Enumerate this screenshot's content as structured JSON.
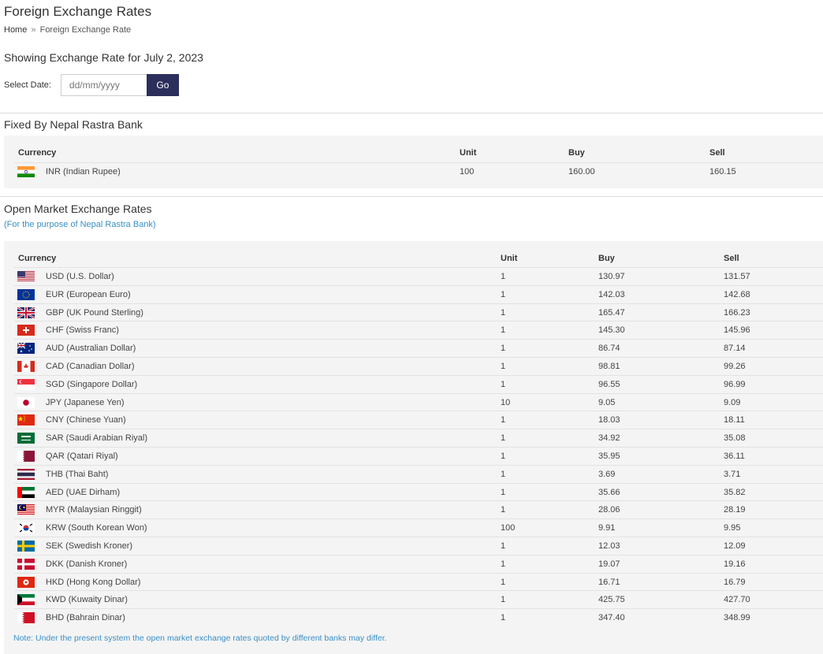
{
  "page": {
    "title": "Foreign Exchange Rates",
    "breadcrumb": {
      "home": "Home",
      "separator": "»",
      "current": "Foreign Exchange Rate"
    },
    "showing": "Showing Exchange Rate for July 2, 2023"
  },
  "date_form": {
    "label": "Select Date:",
    "placeholder": "dd/mm/yyyy",
    "go_label": "Go"
  },
  "fixed": {
    "title": "Fixed By Nepal Rastra Bank",
    "headers": {
      "currency": "Currency",
      "unit": "Unit",
      "buy": "Buy",
      "sell": "Sell"
    },
    "rows": [
      {
        "currency": "INR (Indian Rupee)",
        "flag": "in",
        "unit": "100",
        "buy": "160.00",
        "sell": "160.15"
      }
    ]
  },
  "open_market": {
    "title": "Open Market Exchange Rates",
    "subtitle": "(For the purpose of Nepal Rastra Bank)",
    "headers": {
      "currency": "Currency",
      "unit": "Unit",
      "buy": "Buy",
      "sell": "Sell"
    },
    "rows": [
      {
        "currency": "USD (U.S. Dollar)",
        "flag": "us",
        "unit": "1",
        "buy": "130.97",
        "sell": "131.57"
      },
      {
        "currency": "EUR (European Euro)",
        "flag": "eu",
        "unit": "1",
        "buy": "142.03",
        "sell": "142.68"
      },
      {
        "currency": "GBP (UK Pound Sterling)",
        "flag": "gb",
        "unit": "1",
        "buy": "165.47",
        "sell": "166.23"
      },
      {
        "currency": "CHF (Swiss Franc)",
        "flag": "ch",
        "unit": "1",
        "buy": "145.30",
        "sell": "145.96"
      },
      {
        "currency": "AUD (Australian Dollar)",
        "flag": "au",
        "unit": "1",
        "buy": "86.74",
        "sell": "87.14"
      },
      {
        "currency": "CAD (Canadian Dollar)",
        "flag": "ca",
        "unit": "1",
        "buy": "98.81",
        "sell": "99.26"
      },
      {
        "currency": "SGD (Singapore Dollar)",
        "flag": "sg",
        "unit": "1",
        "buy": "96.55",
        "sell": "96.99"
      },
      {
        "currency": "JPY (Japanese Yen)",
        "flag": "jp",
        "unit": "10",
        "buy": "9.05",
        "sell": "9.09"
      },
      {
        "currency": "CNY (Chinese Yuan)",
        "flag": "cn",
        "unit": "1",
        "buy": "18.03",
        "sell": "18.11"
      },
      {
        "currency": "SAR (Saudi Arabian Riyal)",
        "flag": "sa",
        "unit": "1",
        "buy": "34.92",
        "sell": "35.08"
      },
      {
        "currency": "QAR (Qatari Riyal)",
        "flag": "qa",
        "unit": "1",
        "buy": "35.95",
        "sell": "36.11"
      },
      {
        "currency": "THB (Thai Baht)",
        "flag": "th",
        "unit": "1",
        "buy": "3.69",
        "sell": "3.71"
      },
      {
        "currency": "AED (UAE Dirham)",
        "flag": "ae",
        "unit": "1",
        "buy": "35.66",
        "sell": "35.82"
      },
      {
        "currency": "MYR (Malaysian Ringgit)",
        "flag": "my",
        "unit": "1",
        "buy": "28.06",
        "sell": "28.19"
      },
      {
        "currency": "KRW (South Korean Won)",
        "flag": "kr",
        "unit": "100",
        "buy": "9.91",
        "sell": "9.95"
      },
      {
        "currency": "SEK (Swedish Kroner)",
        "flag": "se",
        "unit": "1",
        "buy": "12.03",
        "sell": "12.09"
      },
      {
        "currency": "DKK (Danish Kroner)",
        "flag": "dk",
        "unit": "1",
        "buy": "19.07",
        "sell": "19.16"
      },
      {
        "currency": "HKD (Hong Kong Dollar)",
        "flag": "hk",
        "unit": "1",
        "buy": "16.71",
        "sell": "16.79"
      },
      {
        "currency": "KWD (Kuwaity Dinar)",
        "flag": "kw",
        "unit": "1",
        "buy": "425.75",
        "sell": "427.70"
      },
      {
        "currency": "BHD (Bahrain Dinar)",
        "flag": "bh",
        "unit": "1",
        "buy": "347.40",
        "sell": "348.99"
      }
    ]
  },
  "note": "Note: Under the present system the open market exchange rates quoted by different banks may differ.",
  "colors": {
    "accent_link": "#3a8fc6",
    "button_bg": "#2c2f5b",
    "panel_bg": "#f4f4f4"
  }
}
